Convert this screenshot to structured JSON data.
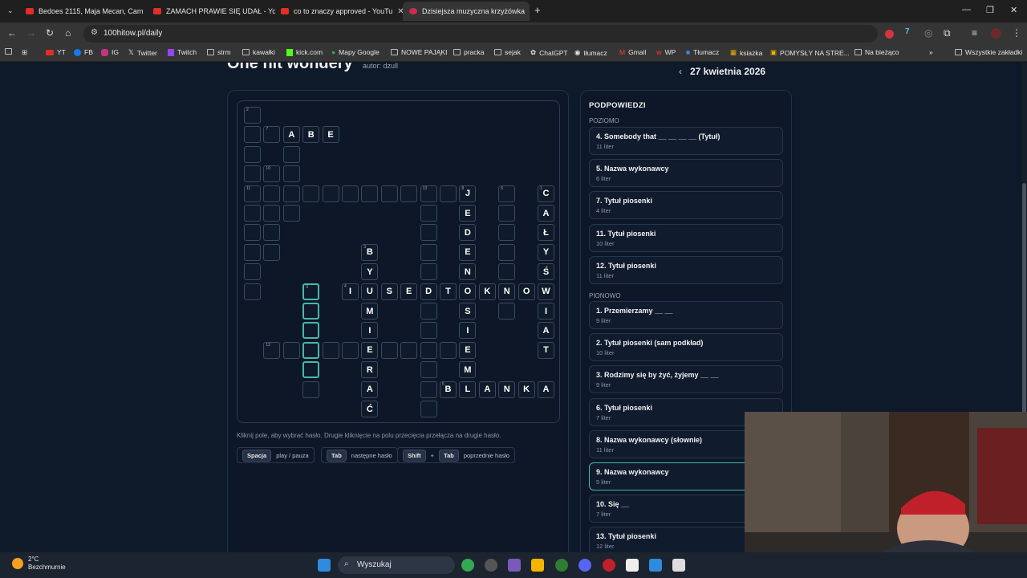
{
  "browser": {
    "tabs": [
      {
        "title": "Bedoes 2115, Maja Mecan, Cam"
      },
      {
        "title": "ZAMACH PRAWIE SIĘ UDAŁ - Yo"
      },
      {
        "title": "co to znaczy approved - YouTu"
      },
      {
        "title": "Dzisiejsza muzyczna krzyżówka"
      }
    ],
    "url": "100hitow.pl/daily",
    "bookmarks": [
      "YT",
      "FB",
      "IG",
      "Twitter",
      "Twitch",
      "strm",
      "kawałki",
      "kick.com",
      "Mapy Google",
      "NOWE PAJĄKI",
      "pracka",
      "sejak",
      "ChatGPT",
      "tłumacz",
      "Gmail",
      "WP",
      "Tłumacz",
      "ksiazka",
      "POMYSŁY NA STRE...",
      "Na bieżąco",
      "Wszystkie zakładki"
    ]
  },
  "page": {
    "title": "One hit wondery",
    "author": "autor: dzull",
    "date": "27 kwietnia 2026",
    "hint": "Kliknij pole, aby wybrać hasło. Drugie kliknięcie na polu przecięcia przełącza na drugie hasło.",
    "shortcuts": {
      "space_key": "Spacja",
      "space_label": "play / pauza",
      "tab_key": "Tab",
      "tab_label": "następne hasło",
      "shift_key": "Shift",
      "plus": "+",
      "tab_key2": "Tab",
      "shift_tab_label": "poprzednie hasło"
    }
  },
  "clues": {
    "title": "PODPOWIEDZI",
    "across_label": "POZIOMO",
    "down_label": "PIONOWO",
    "across": [
      {
        "text": "4. Somebody that __ __ __ __ (Tytuł)",
        "len": "11 liter"
      },
      {
        "text": "5. Nazwa wykonawcy",
        "len": "6 liter"
      },
      {
        "text": "7. Tytuł piosenki",
        "len": "4 liter"
      },
      {
        "text": "11. Tytuł piosenki",
        "len": "10 liter"
      },
      {
        "text": "12. Tytuł piosenki",
        "len": "11 liter"
      }
    ],
    "down": [
      {
        "text": "1. Przemierzamy __ __",
        "len": "9 liter"
      },
      {
        "text": "2. Tytuł piosenki (sam podkład)",
        "len": "10 liter"
      },
      {
        "text": "3. Rodzimy się by żyć, żyjemy __ __",
        "len": "9 liter"
      },
      {
        "text": "6. Tytuł piosenki",
        "len": "7 liter"
      },
      {
        "text": "8. Nazwa wykonawcy (słownie)",
        "len": "11 liter"
      },
      {
        "text": "9. Nazwa wykonawcy",
        "len": "5 liter"
      },
      {
        "text": "10. Się __",
        "len": "7 liter"
      },
      {
        "text": "13. Tytuł piosenki",
        "len": "12 liter"
      }
    ]
  },
  "grid": {
    "cells": [
      [
        0,
        0,
        "",
        "2"
      ],
      [
        0,
        1,
        "",
        ""
      ],
      [
        0,
        2,
        "",
        ""
      ],
      [
        0,
        3,
        "",
        ""
      ],
      [
        0,
        4,
        "",
        ""
      ],
      [
        0,
        5,
        "",
        ""
      ],
      [
        0,
        6,
        "",
        ""
      ],
      [
        0,
        7,
        "",
        ""
      ],
      [
        0,
        8,
        "",
        ""
      ],
      [
        0,
        9,
        "",
        ""
      ],
      [
        1,
        1,
        "",
        "7"
      ],
      [
        2,
        1,
        "A",
        ""
      ],
      [
        3,
        1,
        "B",
        ""
      ],
      [
        4,
        1,
        "E",
        ""
      ],
      [
        2,
        2,
        "",
        ""
      ],
      [
        2,
        3,
        "",
        ""
      ],
      [
        2,
        4,
        "",
        ""
      ],
      [
        2,
        5,
        "",
        ""
      ],
      [
        1,
        3,
        "",
        "10"
      ],
      [
        1,
        4,
        "",
        ""
      ],
      [
        1,
        5,
        "",
        ""
      ],
      [
        1,
        6,
        "",
        ""
      ],
      [
        1,
        7,
        "",
        ""
      ],
      [
        0,
        4,
        "",
        "11"
      ],
      [
        3,
        4,
        "",
        ""
      ],
      [
        4,
        4,
        "",
        ""
      ],
      [
        5,
        4,
        "",
        ""
      ],
      [
        6,
        4,
        "",
        ""
      ],
      [
        7,
        4,
        "",
        ""
      ],
      [
        8,
        4,
        "",
        ""
      ],
      [
        9,
        4,
        "",
        "13"
      ],
      [
        10,
        4,
        "",
        ""
      ],
      [
        3,
        9,
        "",
        "9"
      ],
      [
        3,
        10,
        "",
        ""
      ],
      [
        3,
        11,
        "",
        ""
      ],
      [
        3,
        12,
        "",
        ""
      ],
      [
        3,
        13,
        "",
        ""
      ],
      [
        6,
        7,
        "B",
        "3"
      ],
      [
        6,
        8,
        "Y",
        ""
      ],
      [
        6,
        9,
        "U",
        ""
      ],
      [
        6,
        10,
        "M",
        ""
      ],
      [
        6,
        11,
        "I",
        ""
      ],
      [
        6,
        12,
        "E",
        ""
      ],
      [
        6,
        13,
        "R",
        ""
      ],
      [
        6,
        14,
        "A",
        ""
      ],
      [
        6,
        15,
        "Ć",
        ""
      ],
      [
        5,
        9,
        "I",
        "4"
      ],
      [
        7,
        9,
        "S",
        ""
      ],
      [
        8,
        9,
        "E",
        ""
      ],
      [
        9,
        9,
        "D",
        ""
      ],
      [
        10,
        9,
        "T",
        ""
      ],
      [
        11,
        9,
        "O",
        ""
      ],
      [
        12,
        9,
        "K",
        ""
      ],
      [
        13,
        9,
        "N",
        ""
      ],
      [
        14,
        9,
        "O",
        ""
      ],
      [
        15,
        9,
        "W",
        ""
      ],
      [
        9,
        5,
        "",
        ""
      ],
      [
        9,
        6,
        "",
        ""
      ],
      [
        9,
        7,
        "",
        ""
      ],
      [
        9,
        8,
        "",
        ""
      ],
      [
        9,
        10,
        "",
        ""
      ],
      [
        9,
        11,
        "",
        ""
      ],
      [
        9,
        12,
        "",
        ""
      ],
      [
        9,
        13,
        "",
        ""
      ],
      [
        9,
        14,
        "",
        ""
      ],
      [
        9,
        15,
        "",
        ""
      ],
      [
        11,
        4,
        "J",
        "8"
      ],
      [
        11,
        5,
        "E",
        ""
      ],
      [
        11,
        6,
        "D",
        ""
      ],
      [
        11,
        7,
        "E",
        ""
      ],
      [
        11,
        8,
        "N",
        ""
      ],
      [
        11,
        10,
        "S",
        ""
      ],
      [
        11,
        11,
        "I",
        ""
      ],
      [
        11,
        12,
        "E",
        ""
      ],
      [
        11,
        13,
        "M",
        ""
      ],
      [
        13,
        4,
        "",
        "6"
      ],
      [
        13,
        5,
        "",
        ""
      ],
      [
        13,
        6,
        "",
        ""
      ],
      [
        13,
        7,
        "",
        ""
      ],
      [
        13,
        8,
        "",
        ""
      ],
      [
        13,
        10,
        "",
        ""
      ],
      [
        15,
        4,
        "C",
        "1"
      ],
      [
        15,
        5,
        "A",
        ""
      ],
      [
        15,
        6,
        "Ł",
        ""
      ],
      [
        15,
        7,
        "Y",
        ""
      ],
      [
        15,
        8,
        "Ś",
        ""
      ],
      [
        15,
        10,
        "I",
        ""
      ],
      [
        15,
        11,
        "A",
        ""
      ],
      [
        15,
        12,
        "T",
        ""
      ],
      [
        1,
        12,
        "",
        "12"
      ],
      [
        2,
        12,
        "",
        ""
      ],
      [
        4,
        12,
        "",
        ""
      ],
      [
        5,
        12,
        "",
        ""
      ],
      [
        7,
        12,
        "",
        ""
      ],
      [
        8,
        12,
        "",
        ""
      ],
      [
        10,
        12,
        "",
        ""
      ],
      [
        10,
        14,
        "B",
        "5"
      ],
      [
        11,
        14,
        "L",
        ""
      ],
      [
        12,
        14,
        "A",
        ""
      ],
      [
        13,
        14,
        "N",
        ""
      ],
      [
        14,
        14,
        "K",
        ""
      ],
      [
        15,
        14,
        "A",
        ""
      ],
      [
        3,
        14,
        "",
        ""
      ]
    ]
  },
  "taskbar": {
    "temp": "2°C",
    "weather": "Bezchmurnie",
    "search": "Wyszukaj"
  },
  "colors": {
    "accent": "#48b8a8",
    "page_bg": "#0e1929"
  }
}
